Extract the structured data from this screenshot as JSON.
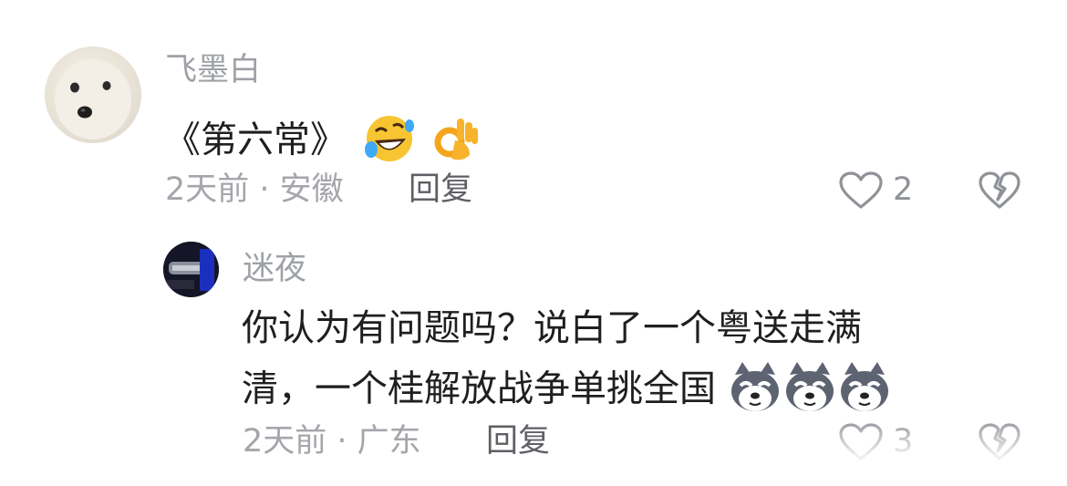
{
  "comment": {
    "username": "飞墨白",
    "text_prefix": "《第六常》",
    "emojis": [
      "rolling-on-floor-laughing-emoji",
      "ok-hand-emoji"
    ],
    "time": "2天前 · 安徽",
    "reply_label": "回复",
    "likes": "2"
  },
  "reply": {
    "username": "迷夜",
    "line1": "你认为有问题吗？说白了一个粤送走满",
    "line2": "清，一个桂解放战争单挑全国",
    "emojis": [
      "husky-dog-emoji",
      "husky-dog-emoji",
      "husky-dog-emoji"
    ],
    "time": "2天前 · 广东",
    "reply_label": "回复",
    "likes": "3"
  },
  "colors": {
    "username": "#9ea1a6",
    "text": "#1f1f1f",
    "meta": "#a4a6ab",
    "reply_button": "#5e6065",
    "icon": "#8f9297"
  }
}
